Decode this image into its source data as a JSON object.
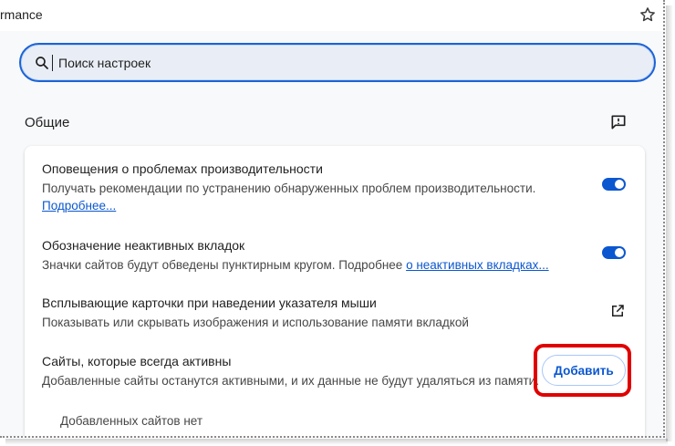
{
  "tab": {
    "title": "rmance"
  },
  "search": {
    "placeholder": "Поиск настроек"
  },
  "section": {
    "title": "Общие"
  },
  "settings": [
    {
      "title": "Оповещения о проблемах производительности",
      "description": "Получать рекомендации по устранению обнаруженных проблем производительности.",
      "link": "Подробнее...",
      "toggle": "on"
    },
    {
      "title": "Обозначение неактивных вкладок",
      "description": "Значки сайтов будут обведены пунктирным кругом. Подробнее ",
      "link": "о неактивных вкладках...",
      "toggle": "on"
    },
    {
      "title": "Всплывающие карточки при наведении указателя мыши",
      "description": "Показывать или скрывать изображения и использование памяти вкладкой",
      "icon": "open-in-new-icon"
    },
    {
      "title": "Сайты, которые всегда активны",
      "description": "Добавленные сайты останутся активными, и их данные не будут удаляться из памяти.",
      "button": "Добавить",
      "empty_note": "Добавленных сайтов нет"
    }
  ],
  "colors": {
    "accent": "#0b57d0",
    "highlight": "#e00000",
    "search_border": "#1b63d6"
  },
  "icons": [
    "star-icon",
    "search-icon",
    "feedback-icon",
    "open-in-new-icon"
  ]
}
